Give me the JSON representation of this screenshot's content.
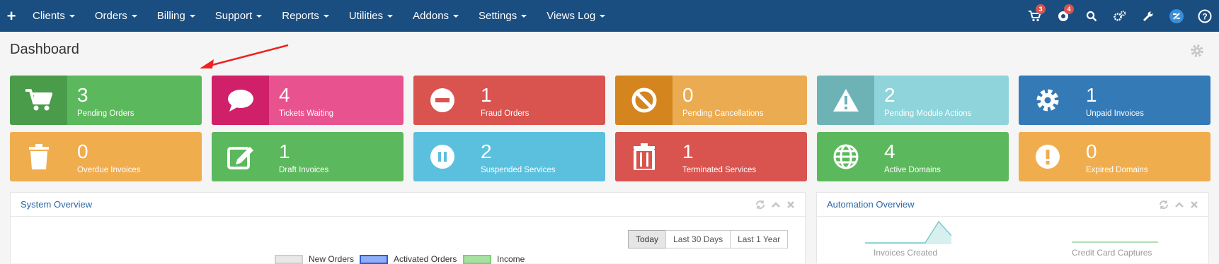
{
  "nav": {
    "items": [
      "Clients",
      "Orders",
      "Billing",
      "Support",
      "Reports",
      "Utilities",
      "Addons",
      "Settings",
      "Views Log"
    ],
    "cart_badge": "3",
    "support_badge": "4"
  },
  "page": {
    "title": "Dashboard"
  },
  "tiles": [
    {
      "value": "3",
      "label": "Pending Orders",
      "icon": "cart-icon",
      "color": "#5cb85c",
      "dark": "#4a9c4a"
    },
    {
      "value": "4",
      "label": "Tickets Waiting",
      "icon": "comment-icon",
      "color": "#e8528e",
      "dark": "#d02069"
    },
    {
      "value": "1",
      "label": "Fraud Orders",
      "icon": "minus-circle-icon",
      "color": "#d9534f",
      "dark": "#d9534f"
    },
    {
      "value": "0",
      "label": "Pending Cancellations",
      "icon": "ban-icon",
      "color": "#eaab51",
      "dark": "#d4851d"
    },
    {
      "value": "2",
      "label": "Pending Module Actions",
      "icon": "warning-icon",
      "color": "#8ed4da",
      "dark": "#6db3b6"
    },
    {
      "value": "1",
      "label": "Unpaid Invoices",
      "icon": "gear-icon",
      "color": "#337ab7",
      "dark": "#337ab7"
    },
    {
      "value": "0",
      "label": "Overdue Invoices",
      "icon": "trash-icon",
      "color": "#f0ad4e",
      "dark": "#f0ad4e"
    },
    {
      "value": "1",
      "label": "Draft Invoices",
      "icon": "edit-icon",
      "color": "#5cb85c",
      "dark": "#5cb85c"
    },
    {
      "value": "2",
      "label": "Suspended Services",
      "icon": "pause-icon",
      "color": "#5bc0de",
      "dark": "#5bc0de"
    },
    {
      "value": "1",
      "label": "Terminated Services",
      "icon": "trash-alt-icon",
      "color": "#d9534f",
      "dark": "#d9534f"
    },
    {
      "value": "4",
      "label": "Active Domains",
      "icon": "globe-icon",
      "color": "#5cb85c",
      "dark": "#5cb85c"
    },
    {
      "value": "0",
      "label": "Expired Domains",
      "icon": "exclamation-icon",
      "color": "#f0ad4e",
      "dark": "#f0ad4e"
    }
  ],
  "system_overview": {
    "title": "System Overview",
    "ranges": [
      "Today",
      "Last 30 Days",
      "Last 1 Year"
    ],
    "legend": [
      "New Orders",
      "Activated Orders",
      "Income"
    ]
  },
  "automation_overview": {
    "title": "Automation Overview",
    "labels": [
      "Invoices Created",
      "Credit Card Captures"
    ]
  }
}
